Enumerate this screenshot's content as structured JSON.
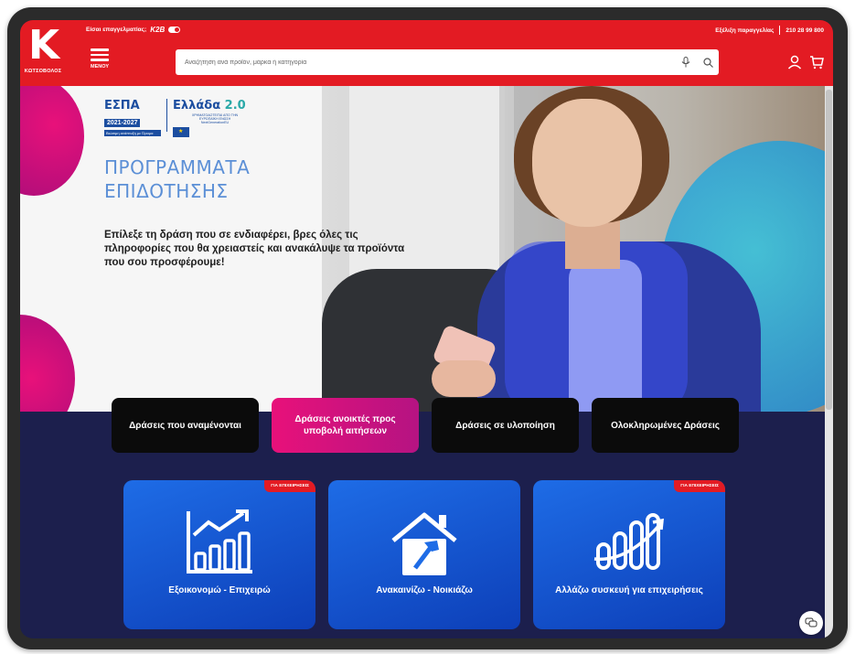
{
  "header": {
    "logo_letter": "K",
    "logo_name": "ΚΩΤΣΟΒΟΛΟΣ",
    "pro_prompt": "Είσαι επαγγελματίας;",
    "pro_brand": "K2B",
    "order_tracking": "Εξέλιξη παραγγελίας",
    "phone": "210 28 99 800",
    "menu_label": "ΜΕΝΟΥ",
    "search_placeholder": "Αναζήτηση ανά προϊόν, μάρκα ή κατηγορία",
    "icons": [
      "mic-icon",
      "search-icon",
      "user-icon",
      "cart-icon"
    ]
  },
  "hero": {
    "espa_title": "ΕΣΠΑ",
    "espa_years": "2021-2027",
    "espa_tagline": "Βιώσιμη ανάπτυξη με Όραμα",
    "greece_title": "Ελλάδα",
    "greece_version": "2.0",
    "greece_sub": "ΧΡΗΜΑΤΟΔΟΤΕΙΤΑΙ ΑΠΟ ΤΗΝ ΕΥΡΩΠΑΪΚΗ ΕΝΩΣΗ NextGenerationEU",
    "title_line1": "ΠΡΟΓΡΑΜΜΑΤΑ",
    "title_line2": "ΕΠΙΔΟΤΗΣΗΣ",
    "description": "Επίλεξε τη δράση που σε ενδιαφέρει, βρες όλες τις πληροφορίες που θα χρειαστείς και ανακάλυψε τα προϊόντα που σου προσφέρουμε!"
  },
  "tabs": [
    {
      "label": "Δράσεις που αναμένονται",
      "active": false
    },
    {
      "label": "Δράσεις ανοικτές προς υποβολή αιτήσεων",
      "active": true
    },
    {
      "label": "Δράσεις σε υλοποίηση",
      "active": false
    },
    {
      "label": "Ολοκληρωμένες Δράσεις",
      "active": false
    }
  ],
  "cards": [
    {
      "label": "Εξοικονομώ - Επιχειρώ",
      "badge": "ΓΙΑ ΕΠΙΧΕΙΡΗΣΕΙΣ",
      "icon": "growth-chart-icon"
    },
    {
      "label": "Ανακαινίζω - Νοικιάζω",
      "badge": "",
      "icon": "house-hammer-icon"
    },
    {
      "label": "Αλλάζω συσκευή για επιχειρήσεις",
      "badge": "ΓΙΑ ΕΠΙΧΕΙΡΗΣΕΙΣ",
      "icon": "coins-growth-icon"
    }
  ],
  "colors": {
    "brand_red": "#e31b23",
    "navy_bg": "#1c1f4d",
    "pink_active": "#e8117a",
    "card_blue": "#1e6ce6",
    "title_blue": "#5b8fd6"
  }
}
